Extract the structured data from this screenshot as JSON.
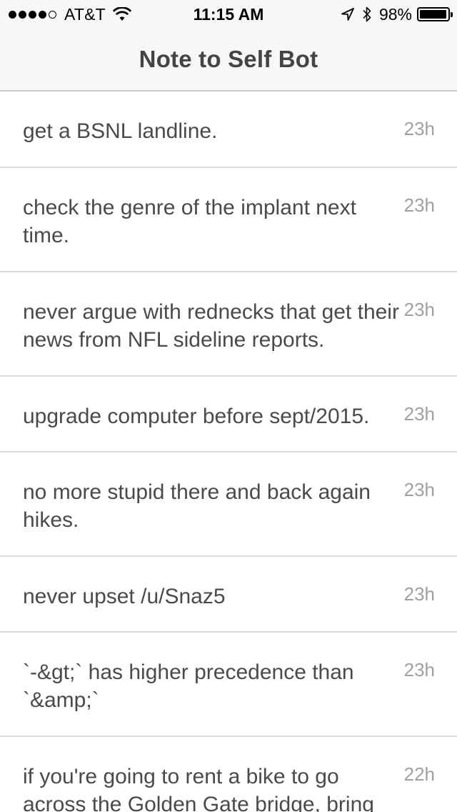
{
  "status_bar": {
    "carrier": "AT&T",
    "signal_bars_filled": 4,
    "signal_bars_total": 5,
    "time": "11:15 AM",
    "battery_percent_label": "98%",
    "battery_level": 0.98,
    "icons": [
      "wifi-icon",
      "location-arrow-icon",
      "bluetooth-icon",
      "battery-icon"
    ]
  },
  "nav": {
    "title": "Note to Self Bot"
  },
  "notes": [
    {
      "text": "get a BSNL landline.",
      "time": "23h"
    },
    {
      "text": "check the genre of the implant next time.",
      "time": "23h"
    },
    {
      "text": "never argue with rednecks that get their news from NFL sideline reports.",
      "time": "23h"
    },
    {
      "text": "upgrade computer before sept/2015.",
      "time": "23h"
    },
    {
      "text": "no more stupid there and back again hikes.",
      "time": "23h"
    },
    {
      "text": "never upset /u/Snaz5",
      "time": "23h"
    },
    {
      "text": "`-&gt;` has higher precedence than `&amp;`",
      "time": "23h"
    },
    {
      "text": "if you're going to rent a bike to go across the Golden Gate bridge, bring",
      "time": "22h"
    }
  ],
  "colors": {
    "nav_background": "#f7f7f7",
    "title_text": "#444444",
    "note_text": "#4a4a4a",
    "timestamp_text": "#a0a0a0",
    "separator": "#dcdcdc"
  }
}
